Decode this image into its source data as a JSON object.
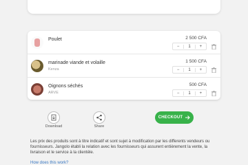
{
  "cart": {
    "items": [
      {
        "name": "Poulet",
        "subtitle": "",
        "price": "2 500 CFA",
        "quantity": "1",
        "minus": "−",
        "plus": "+"
      },
      {
        "name": "marinade viande et volaille",
        "subtitle": "Kenza",
        "price": "1 500 CFA",
        "quantity": "1",
        "minus": "−",
        "plus": "+"
      },
      {
        "name": "Oignons séchés",
        "subtitle": "ARVE",
        "price": "500 CFA",
        "quantity": "1",
        "minus": "−",
        "plus": "+"
      }
    ]
  },
  "actions": {
    "download_label": "Download",
    "share_label": "Share",
    "checkout_label": "CHECKOUT"
  },
  "disclaimer": "Les prix des produits sont à titre indicatif et sont sujet à modification par les differents vendeurs ou fournisseurs. Jangolo établi la relation avec les fournisseurs qui assurent entièrement la vente, la livraison et le service à la clientèle.",
  "how_link": "How does this work?",
  "icons": {
    "download": "download-icon",
    "share": "share-icon",
    "trash": "trash-icon",
    "arrow": "arrow-right-icon"
  },
  "colors": {
    "checkout_bg": "#38b24a",
    "link": "#3a78c2"
  }
}
